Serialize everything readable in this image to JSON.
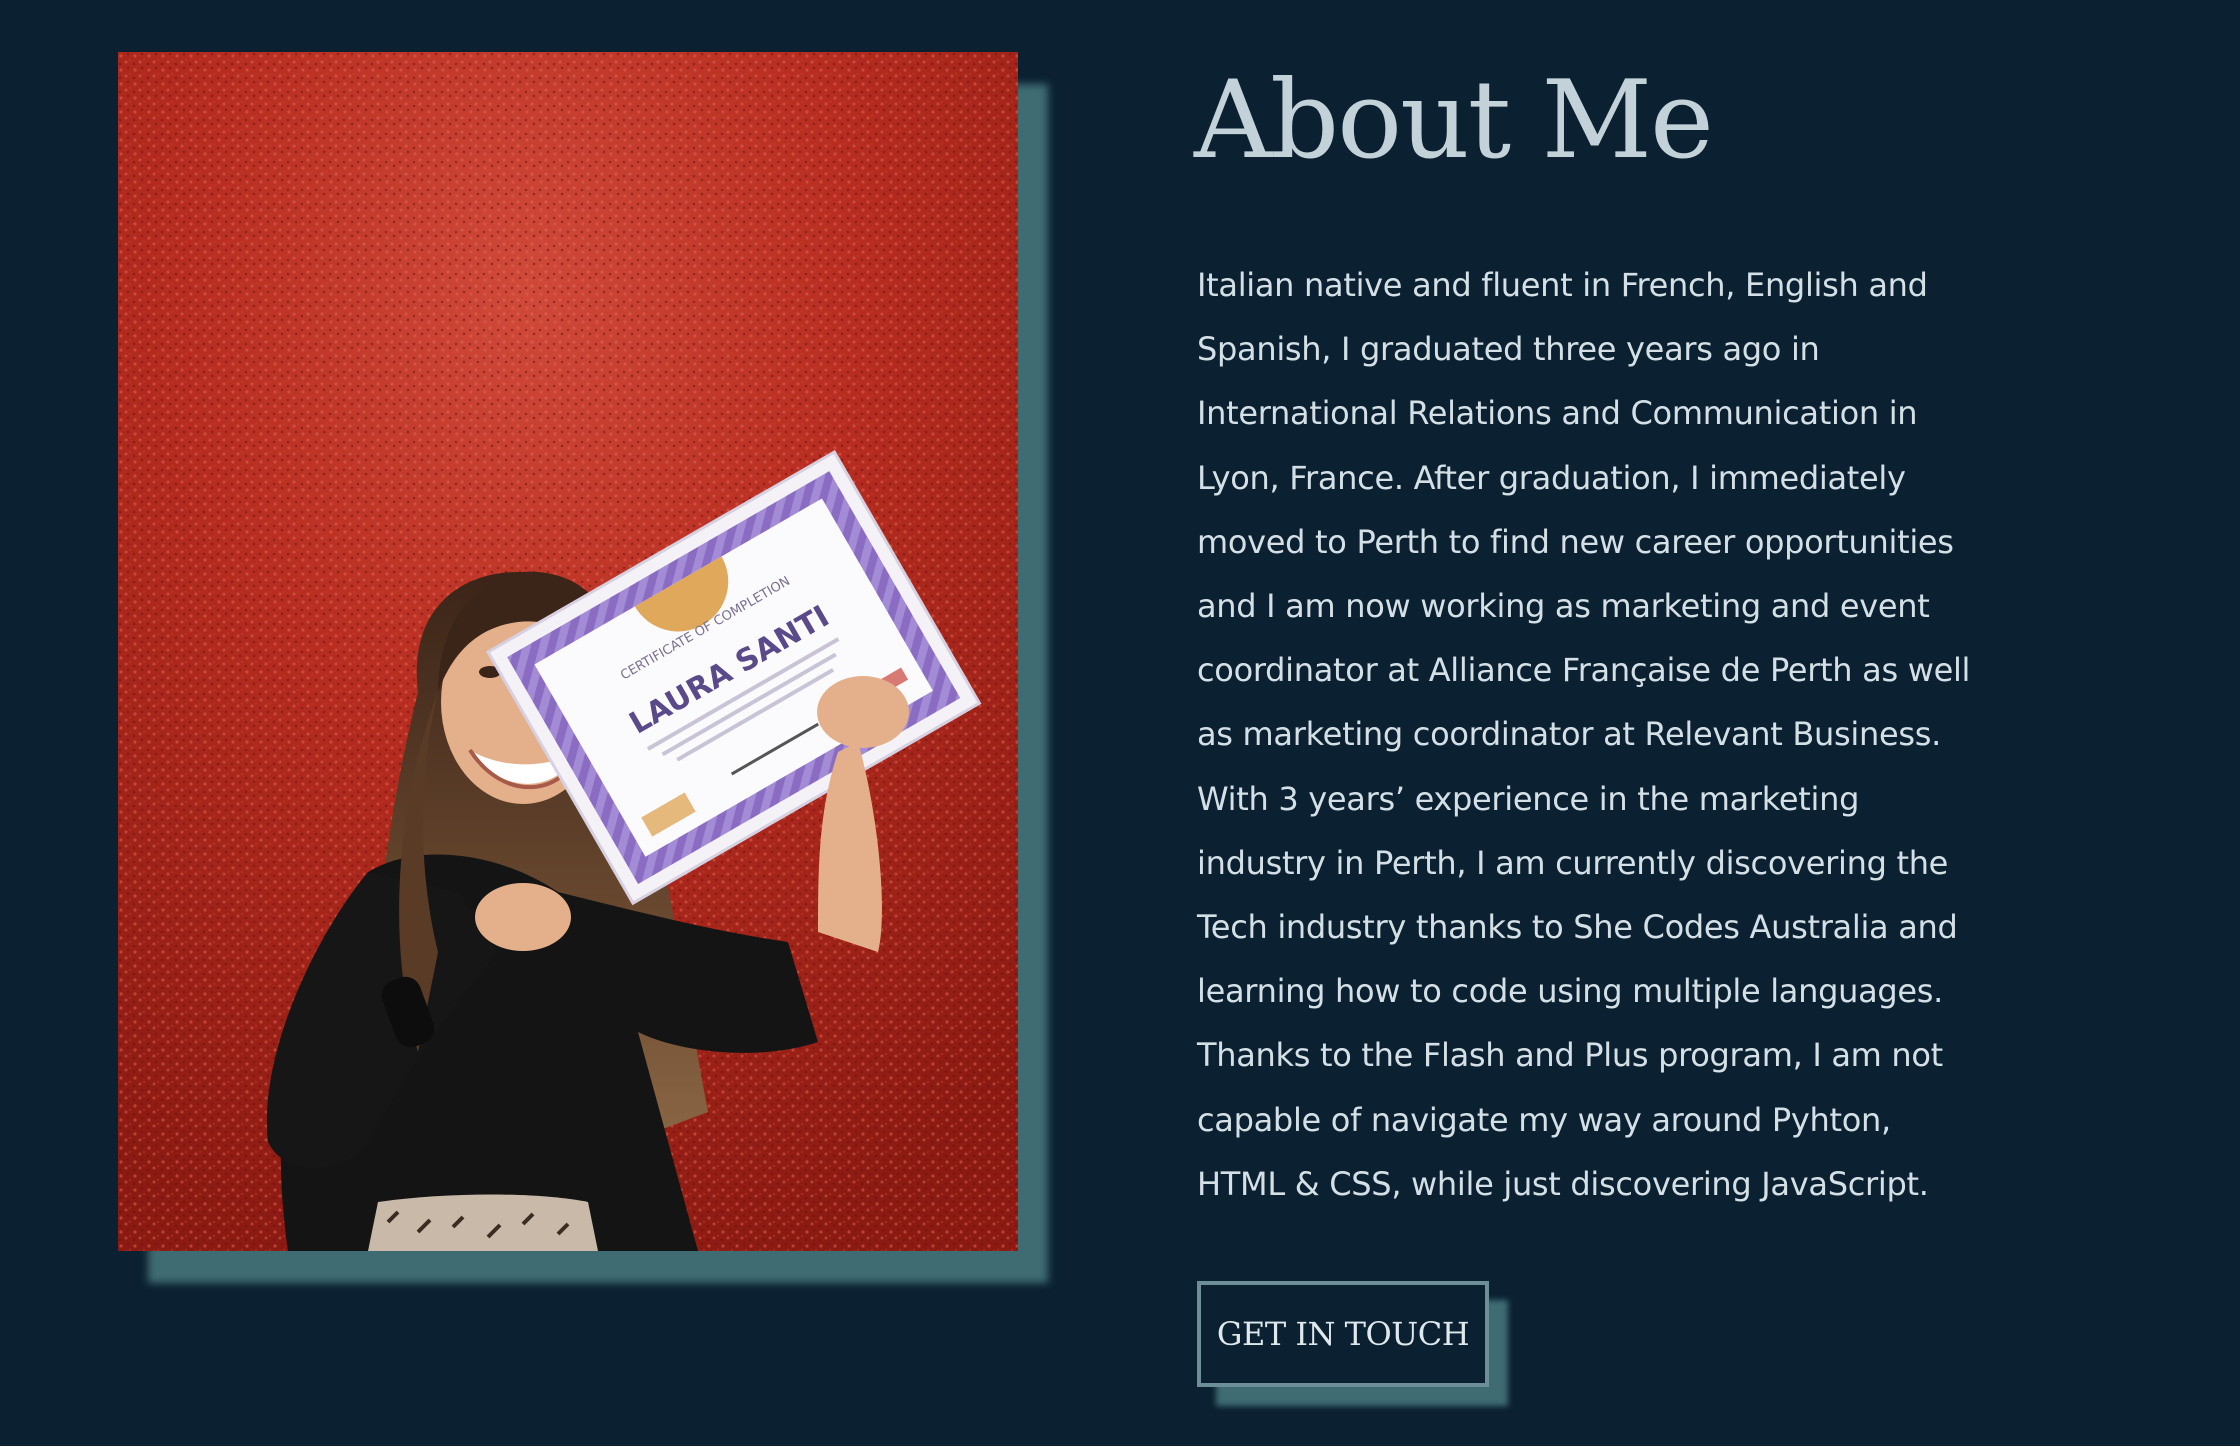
{
  "about": {
    "heading": "About Me",
    "bio": "Italian native and fluent in French, English and Spanish, I graduated three years ago in International Relations and Communication in Lyon, France. After graduation, I immediately moved to Perth to find new career opportunities and I am now working as marketing and event coordinator at Alliance Française de Perth as well as marketing coordinator at Relevant Business. With 3 years’ experience in the marketing industry in Perth, I am currently discovering the Tech industry thanks to She Codes Australia and learning how to code using multiple languages. Thanks to the Flash and Plus program, I am not capable of navigate my way around Pyhton, HTML & CSS, while just discovering JavaScript.",
    "cta_label": "GET IN TOUCH"
  },
  "photo": {
    "certificate_heading": "CERTIFICATE OF COMPLETION",
    "certificate_name": "LAURA SANTI"
  },
  "colors": {
    "background": "#0b2131",
    "heading": "#c3d2d9",
    "body_text": "#d4e0e6",
    "accent_shadow": "#3f6b73",
    "button_border": "#6d8f98"
  }
}
